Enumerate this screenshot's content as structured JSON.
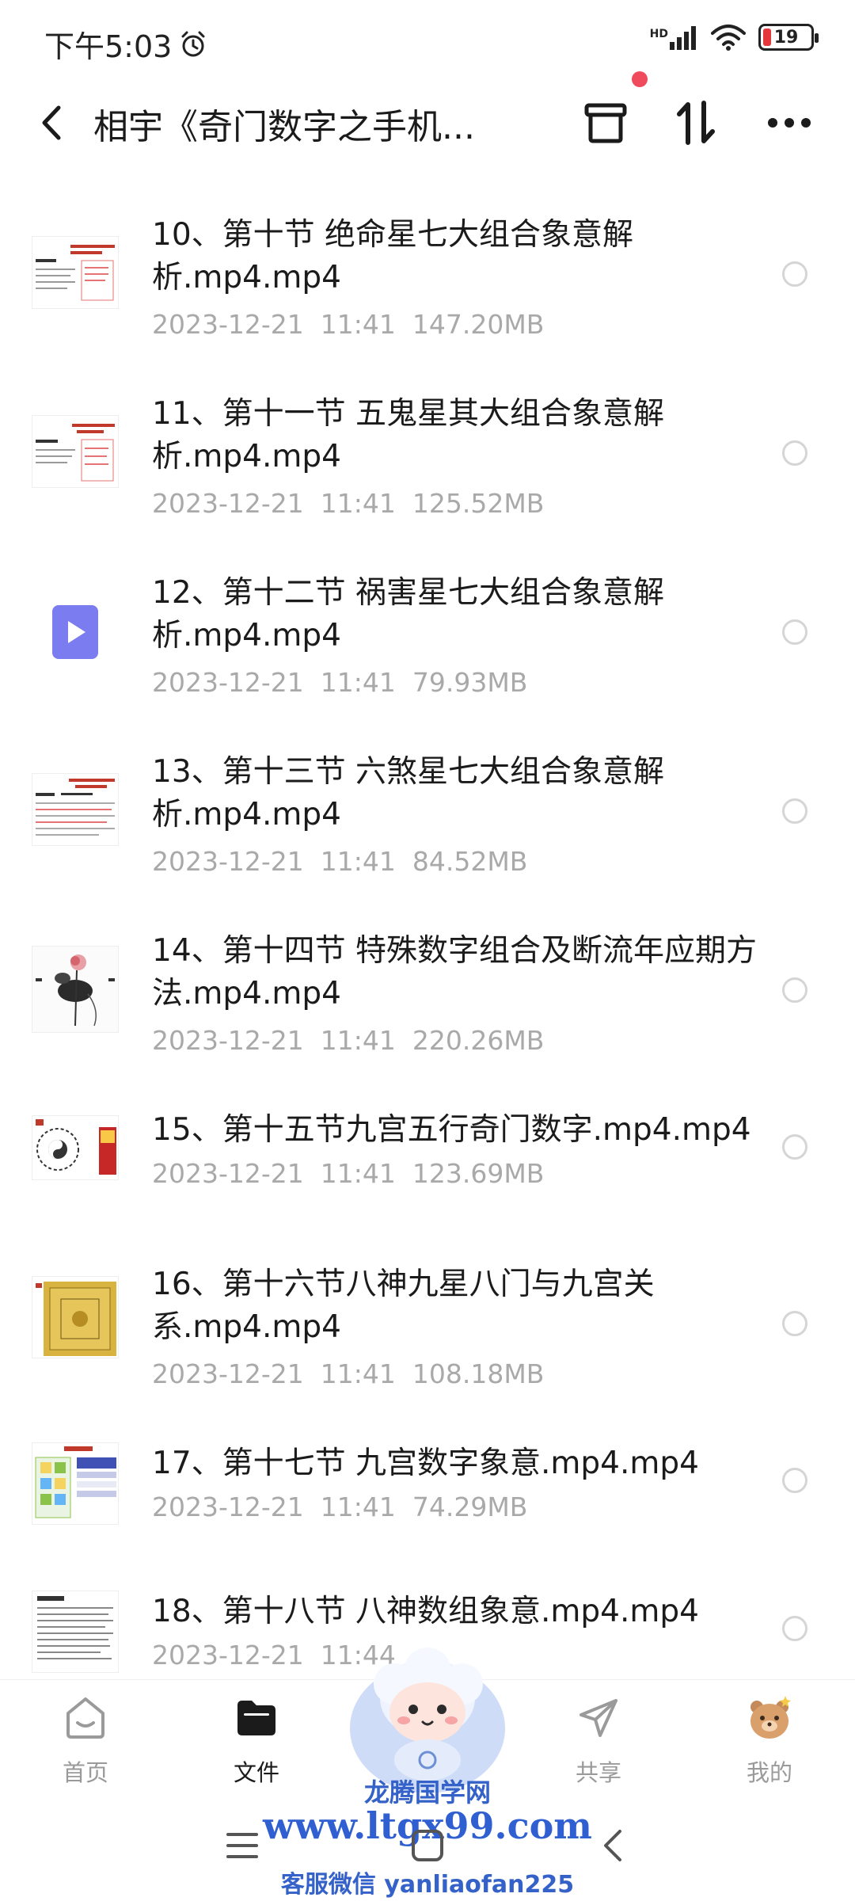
{
  "status_bar": {
    "time": "下午5:03",
    "network": "HD",
    "battery": "19"
  },
  "header": {
    "title": "相宇《奇门数字之手机..."
  },
  "files": [
    {
      "name": "10、第十节 绝命星七大组合象意解析.mp4.mp4",
      "date": "2023-12-21",
      "time": "11:41",
      "size": "147.20MB",
      "thumb": "doc-red"
    },
    {
      "name": "11、第十一节 五鬼星其大组合象意解析.mp4.mp4",
      "date": "2023-12-21",
      "time": "11:41",
      "size": "125.52MB",
      "thumb": "doc-red"
    },
    {
      "name": "12、第十二节 祸害星七大组合象意解析.mp4.mp4",
      "date": "2023-12-21",
      "time": "11:41",
      "size": "79.93MB",
      "thumb": "video-icon"
    },
    {
      "name": "13、第十三节 六煞星七大组合象意解析.mp4.mp4",
      "date": "2023-12-21",
      "time": "11:41",
      "size": "84.52MB",
      "thumb": "doc-red"
    },
    {
      "name": "14、第十四节 特殊数字组合及断流年应期方法.mp4.mp4",
      "date": "2023-12-21",
      "time": "11:41",
      "size": "220.26MB",
      "thumb": "lotus"
    },
    {
      "name": "15、第十五节九宫五行奇门数字.mp4.mp4",
      "date": "2023-12-21",
      "time": "11:41",
      "size": "123.69MB",
      "thumb": "bagua"
    },
    {
      "name": "16、第十六节八神九星八门与九宫关系.mp4.mp4",
      "date": "2023-12-21",
      "time": "11:41",
      "size": "108.18MB",
      "thumb": "gold-chart"
    },
    {
      "name": "17、第十七节 九宫数字象意.mp4.mp4",
      "date": "2023-12-21",
      "time": "11:41",
      "size": "74.29MB",
      "thumb": "grid-chart"
    },
    {
      "name": "18、第十八节 八神数组象意.mp4.mp4",
      "date": "2023-12-21",
      "time": "11:44",
      "size": "",
      "thumb": "doc-list"
    }
  ],
  "nav": {
    "home": "首页",
    "files": "文件",
    "share": "共享",
    "mine": "我的"
  },
  "watermark": {
    "site": "龙腾国学网",
    "url": "www.ltgx99.com",
    "contact": "客服微信 yanliaofan225"
  },
  "colors": {
    "accent_purple": "#7b7cf0",
    "notification_red": "#f04b5c",
    "watermark_blue": "#2f5fd0",
    "meta_gray": "#a9a9a9"
  }
}
